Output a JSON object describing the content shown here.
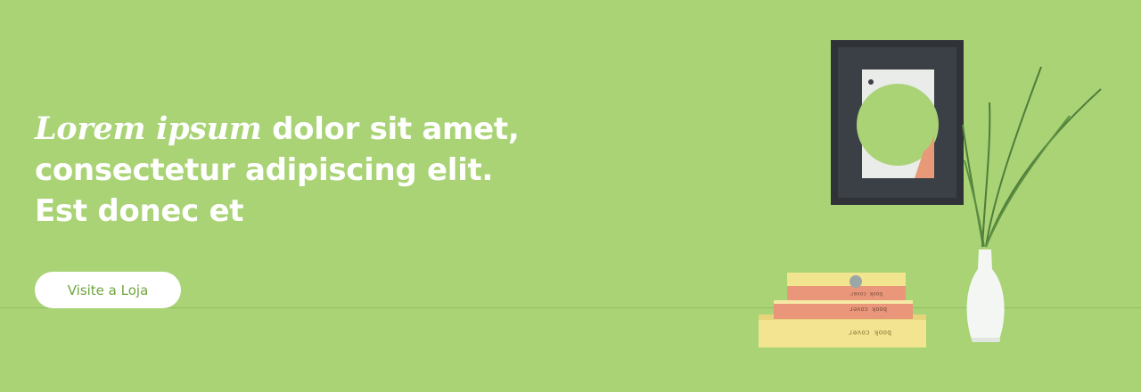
{
  "hero": {
    "headline_script": "Lorem ipsum",
    "headline_rest": "dolor sit amet, consectetur adipiscing elit. Est donec et",
    "cta_label": "Visite a Loja"
  },
  "decor": {
    "book_top_text": "book cover",
    "book_mid_text": "book cover",
    "book_bottom_text": "book cover"
  },
  "colors": {
    "background": "#a9d375",
    "button_bg": "#ffffff",
    "button_text": "#6fa63f",
    "headline_text": "#ffffff"
  }
}
